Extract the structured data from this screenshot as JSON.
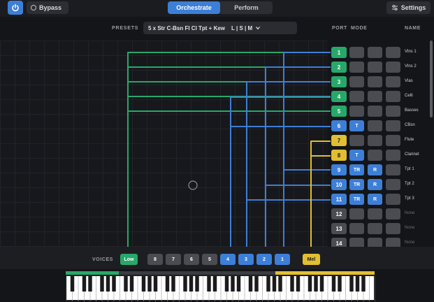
{
  "header": {
    "bypass_label": "Bypass",
    "modes": [
      "Orchestrate",
      "Perform"
    ],
    "active_mode": "Orchestrate",
    "settings_label": "Settings"
  },
  "presets": {
    "label": "PRESETS",
    "value": "5 x Str C-Bsn Fl Cl Tpt + Kew",
    "size_options": "L | S | M"
  },
  "columns": {
    "port": "PORT",
    "mode": "MODE",
    "name": "NAME"
  },
  "ports": [
    {
      "port": "1",
      "color": "green",
      "modes": [],
      "name": "Vlns 1"
    },
    {
      "port": "2",
      "color": "green",
      "modes": [],
      "name": "Vlns 2"
    },
    {
      "port": "3",
      "color": "green",
      "modes": [],
      "name": "Vlas"
    },
    {
      "port": "4",
      "color": "green",
      "modes": [],
      "name": "Celli"
    },
    {
      "port": "5",
      "color": "green",
      "modes": [],
      "name": "Basses"
    },
    {
      "port": "6",
      "color": "blue",
      "modes": [
        "T"
      ],
      "name": "CBsn"
    },
    {
      "port": "7",
      "color": "yellow",
      "modes": [],
      "name": "Flute"
    },
    {
      "port": "8",
      "color": "yellow",
      "modes": [
        "T"
      ],
      "name": "Clarinet"
    },
    {
      "port": "9",
      "color": "blue",
      "modes": [
        "TR",
        "R"
      ],
      "name": "Tpt 1"
    },
    {
      "port": "10",
      "color": "blue",
      "modes": [
        "TR",
        "R"
      ],
      "name": "Tpt 2"
    },
    {
      "port": "11",
      "color": "blue",
      "modes": [
        "TR",
        "R"
      ],
      "name": "Tpt 3"
    },
    {
      "port": "12",
      "color": "gray",
      "modes": [],
      "name": "None"
    },
    {
      "port": "13",
      "color": "gray",
      "modes": [],
      "name": "None"
    },
    {
      "port": "14",
      "color": "gray",
      "modes": [],
      "name": "None"
    }
  ],
  "voices": {
    "label": "VOICES",
    "low_label": "Low",
    "buttons": [
      "8",
      "7",
      "6",
      "5",
      "4",
      "3",
      "2",
      "1"
    ],
    "active_buttons": [
      "4",
      "3",
      "2",
      "1"
    ],
    "mel_label": "Mel"
  },
  "colors": {
    "accent_blue": "#3d7fd6",
    "green": "#27a86a",
    "yellow": "#e2be32",
    "gray": "#4a4c52"
  },
  "icons": {
    "power": "power-icon",
    "bypass": "circle-icon",
    "settings": "sliders-icon",
    "preset_dropdown": "chevron-down-icon",
    "grid_cursor": "circle-cursor-icon"
  }
}
